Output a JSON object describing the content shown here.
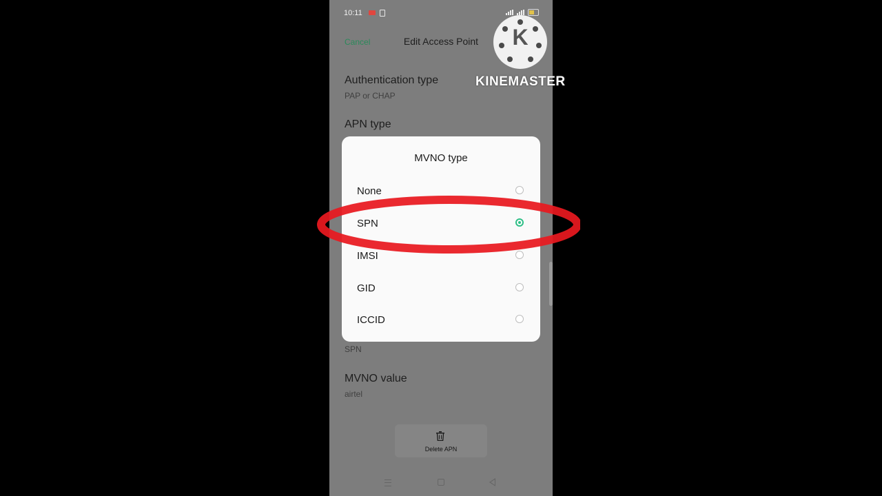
{
  "status_bar": {
    "time": "10:11"
  },
  "header": {
    "cancel_label": "Cancel",
    "title": "Edit Access Point"
  },
  "settings": [
    {
      "label": "Authentication type",
      "value": "PAP or CHAP"
    },
    {
      "label": "APN type",
      "value": ""
    },
    {
      "label": "",
      "value": "SPN"
    },
    {
      "label": "MVNO value",
      "value": "airtel"
    }
  ],
  "dialog": {
    "title": "MVNO type",
    "options": [
      {
        "label": "None",
        "selected": false
      },
      {
        "label": "SPN",
        "selected": true
      },
      {
        "label": "IMSI",
        "selected": false
      },
      {
        "label": "GID",
        "selected": false
      },
      {
        "label": "ICCID",
        "selected": false
      }
    ]
  },
  "delete_button": {
    "label": "Delete APN"
  },
  "watermark": {
    "text": "KINEMASTER",
    "logo_letter": "K"
  },
  "colors": {
    "accent": "#2fbf87",
    "cancel": "#2a8a5a",
    "highlight_ellipse": "#e8191f"
  },
  "icons": {
    "delete": "trash-icon",
    "nav_menu": "menu-icon",
    "nav_home": "home-icon",
    "nav_back": "back-icon"
  }
}
